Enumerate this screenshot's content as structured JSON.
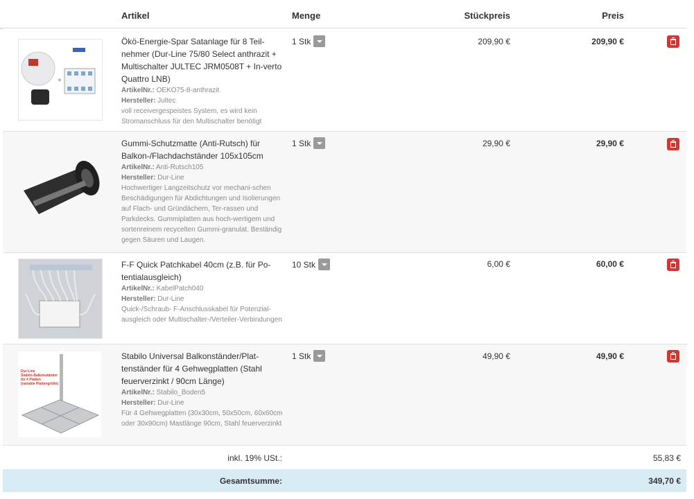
{
  "header": {
    "artikel": "Artikel",
    "menge": "Menge",
    "stueckpreis": "Stückpreis",
    "preis": "Preis"
  },
  "items": [
    {
      "title": "Ökö-Energie-Spar Satanlage für 8 Teil-nehmer (Dur-Line 75/80 Select anthrazit + Multischalter JULTEC JRM0508T + In-verto Quattro LNB)",
      "artnr_label": "ArtikelNr.:",
      "artnr": "OEKO75-8-anthrazit",
      "hersteller_label": "Hersteller:",
      "hersteller": "Jultec",
      "note": "voll receivergespeistes System, es wird kein Stromanschluss für den Multischalter benötigt",
      "qty": "1 Stk",
      "unit_price": "209,90 €",
      "price": "209,90 €"
    },
    {
      "title": "Gummi-Schutzmatte (Anti-Rutsch) für Balkon-/Flachdachständer 105x105cm",
      "artnr_label": "ArtikelNr.:",
      "artnr": "Anti-Rutsch105",
      "hersteller_label": "Hersteller:",
      "hersteller": "Dur-Line",
      "note": "Hochwertiger Langzeitschutz vor mechani-schen Beschädigungen für Abdichtungen und Isolierungen auf Flach- und Gründächern, Ter-rassen und Parkdecks. Gummiplatten aus hoch-wertigem und sortenreinem recycelten Gummi-granulat. Beständig gegen Säuren und Laugen.",
      "qty": "1 Stk",
      "unit_price": "29,90 €",
      "price": "29,90 €"
    },
    {
      "title": "F-F Quick Patchkabel 40cm (z.B. für Po-tentialausgleich)",
      "artnr_label": "ArtikelNr.:",
      "artnr": "KabelPatch040",
      "hersteller_label": "Hersteller:",
      "hersteller": "Dur-Line",
      "note": "Quick-/Schraub- F-Anschlusskabel für Potenzial-ausgleich oder Multischalter-/Verteiler-Verbindungen",
      "qty": "10 Stk",
      "unit_price": "6,00 €",
      "price": "60,00 €"
    },
    {
      "title": "Stabilo Universal Balkonständer/Plat-tenständer für 4 Gehwegplatten (Stahl feuerverzinkt / 90cm Länge)",
      "artnr_label": "ArtikelNr.:",
      "artnr": "Stabilo_Boden5",
      "hersteller_label": "Hersteller:",
      "hersteller": "Dur-Line",
      "note": "Für 4 Gehwegplatten (30x30cm, 50x50cm, 60x60cm oder 30x90cm) Mastlänge 90cm, Stahl feuerverzinkt",
      "qty": "1 Stk",
      "unit_price": "49,90 €",
      "price": "49,90 €",
      "image_text": [
        "Dur-Line",
        "Stabilo-Balkonständer",
        "für 4 Platten",
        "(variable Plattengröße)"
      ]
    }
  ],
  "tax": {
    "label": "inkl. 19% USt.:",
    "value": "55,83 €"
  },
  "total": {
    "label": "Gesamtsumme:",
    "value": "349,70 €"
  },
  "colors": {
    "accent": "#d9332f",
    "total_bg": "#d8ecf6"
  }
}
